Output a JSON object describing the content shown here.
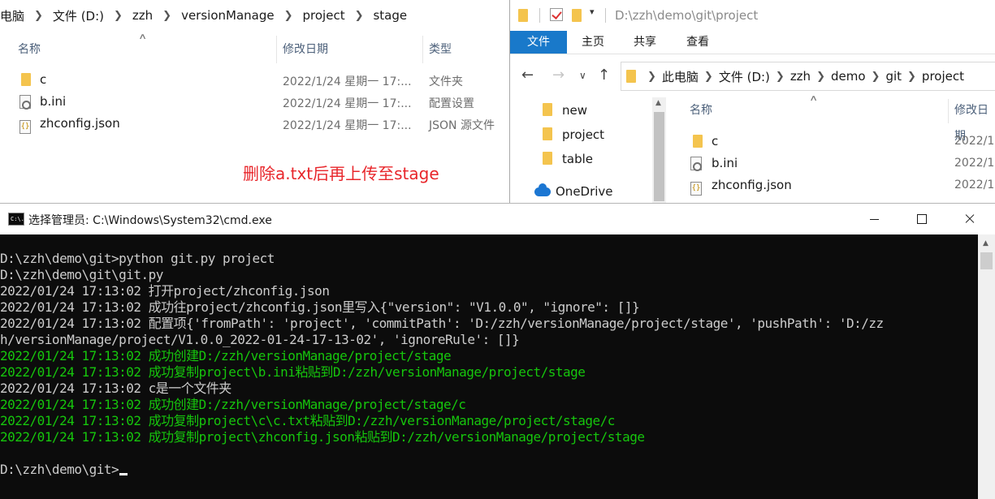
{
  "left_explorer": {
    "breadcrumb": [
      "电脑",
      "文件 (D:)",
      "zzh",
      "versionManage",
      "project",
      "stage"
    ],
    "columns": {
      "name": "名称",
      "date": "修改日期",
      "type": "类型"
    },
    "files": [
      {
        "name": "c",
        "date": "2022/1/24 星期一 17:...",
        "type": "文件夹",
        "icon": "folder-icon"
      },
      {
        "name": "b.ini",
        "date": "2022/1/24 星期一 17:...",
        "type": "配置设置",
        "icon": "ini-file-icon"
      },
      {
        "name": "zhconfig.json",
        "date": "2022/1/24 星期一 17:...",
        "type": "JSON 源文件",
        "icon": "json-file-icon"
      }
    ],
    "annotation": "删除a.txt后再上传至stage",
    "annotation_color": "#e8262b"
  },
  "right_explorer": {
    "title": "D:\\zzh\\demo\\git\\project",
    "ribbon_tabs": [
      "文件",
      "主页",
      "共享",
      "查看"
    ],
    "breadcrumb": [
      "此电脑",
      "文件 (D:)",
      "zzh",
      "demo",
      "git",
      "project"
    ],
    "nav_items": [
      "new",
      "project",
      "table",
      "OneDrive"
    ],
    "columns": {
      "name": "名称",
      "date": "修改日期"
    },
    "files": [
      {
        "name": "c",
        "date": "2022/1",
        "icon": "folder-icon"
      },
      {
        "name": "b.ini",
        "date": "2022/1",
        "icon": "ini-file-icon"
      },
      {
        "name": "zhconfig.json",
        "date": "2022/1",
        "icon": "json-file-icon"
      }
    ],
    "accent_color": "#1979ca"
  },
  "cmd": {
    "title": "选择管理员: C:\\Windows\\System32\\cmd.exe",
    "icon_label": "C:\\.",
    "lines": [
      {
        "text": "D:\\zzh\\demo\\git>python git.py project",
        "green": false
      },
      {
        "text": "D:\\zzh\\demo\\git\\git.py",
        "green": false
      },
      {
        "text": "2022/01/24 17:13:02 打开project/zhconfig.json",
        "green": false
      },
      {
        "text": "2022/01/24 17:13:02 成功往project/zhconfig.json里写入{\"version\": \"V1.0.0\", \"ignore\": []}",
        "green": false
      },
      {
        "text": "2022/01/24 17:13:02 配置项{'fromPath': 'project', 'commitPath': 'D:/zzh/versionManage/project/stage', 'pushPath': 'D:/zz",
        "green": false
      },
      {
        "text": "h/versionManage/project/V1.0.0_2022-01-24-17-13-02', 'ignoreRule': []}",
        "green": false
      },
      {
        "text": "2022/01/24 17:13:02 成功创建D:/zzh/versionManage/project/stage",
        "green": true
      },
      {
        "text": "2022/01/24 17:13:02 成功复制project\\b.ini粘贴到D:/zzh/versionManage/project/stage",
        "green": true
      },
      {
        "text": "2022/01/24 17:13:02 c是一个文件夹",
        "green": false
      },
      {
        "text": "2022/01/24 17:13:02 成功创建D:/zzh/versionManage/project/stage/c",
        "green": true
      },
      {
        "text": "2022/01/24 17:13:02 成功复制project\\c\\c.txt粘贴到D:/zzh/versionManage/project/stage/c",
        "green": true
      },
      {
        "text": "2022/01/24 17:13:02 成功复制project\\zhconfig.json粘贴到D:/zzh/versionManage/project/stage",
        "green": true
      },
      {
        "text": "",
        "green": false
      },
      {
        "text": "D:\\zzh\\demo\\git>",
        "green": false
      }
    ],
    "colors": {
      "background": "#0c0c0c",
      "text": "#cccccc",
      "success": "#16c60c"
    }
  }
}
